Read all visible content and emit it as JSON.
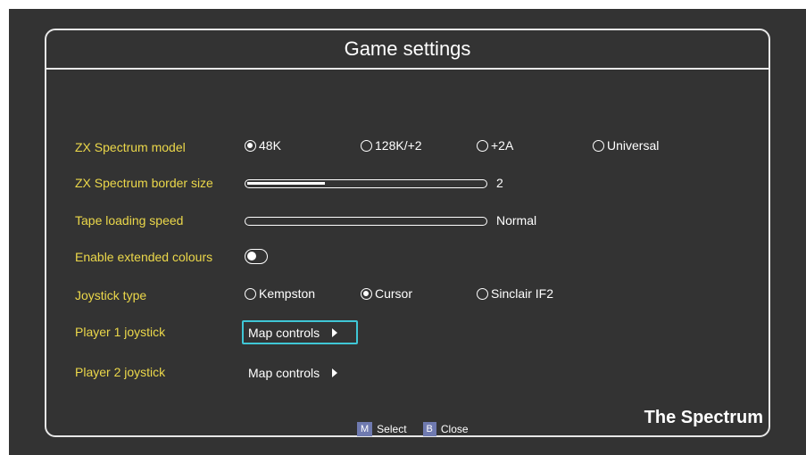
{
  "title": "Game settings",
  "rows": {
    "model": {
      "label": "ZX Spectrum model",
      "options": [
        "48K",
        "128K/+2",
        "+2A",
        "Universal"
      ],
      "selected": "48K"
    },
    "border": {
      "label": "ZX Spectrum border size",
      "value": "2",
      "level": 0.33
    },
    "tape": {
      "label": "Tape loading speed",
      "value": "Normal",
      "level": 0
    },
    "colours": {
      "label": "Enable extended colours",
      "enabled": false
    },
    "joystick": {
      "label": "Joystick type",
      "options": [
        "Kempston",
        "Cursor",
        "Sinclair IF2"
      ],
      "selected": "Cursor"
    },
    "player1": {
      "label": "Player 1 joystick",
      "button": "Map controls"
    },
    "player2": {
      "label": "Player 2 joystick",
      "button": "Map controls"
    }
  },
  "footer": {
    "select_key": "M",
    "select_label": "Select",
    "close_key": "B",
    "close_label": "Close"
  },
  "brand": "The Spectrum",
  "colors": {
    "background": "#333333",
    "label": "#ecd84a",
    "text": "#ffffff",
    "focus": "#3fc7d6",
    "key_badge": "#6f7ab0"
  },
  "icons": {
    "radio": "radio-icon",
    "arrow": "arrow-right-icon"
  }
}
